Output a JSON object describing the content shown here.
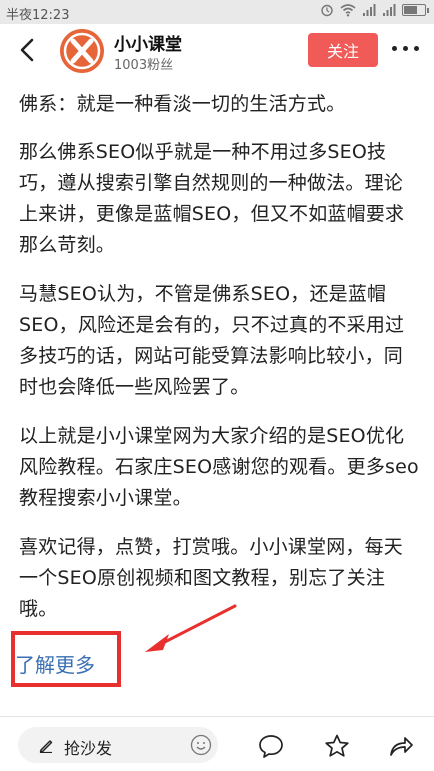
{
  "status_bar": {
    "time": "半夜12:23"
  },
  "header": {
    "account_name": "小小课堂",
    "fans": "1003粉丝",
    "follow_label": "关注",
    "avatar_color": "#e6663a",
    "follow_color": "#f05a57"
  },
  "article": {
    "paragraphs": [
      "佛系：就是一种看淡一切的生活方式。",
      "那么佛系SEO似乎就是一种不用过多SEO技巧，遵从搜索引擎自然规则的一种做法。理论上来讲，更像是蓝帽SEO，但又不如蓝帽要求那么苛刻。",
      "马慧SEO认为，不管是佛系SEO，还是蓝帽SEO，风险还是会有的，只不过真的不采用过多技巧的话，网站可能受算法影响比较小，同时也会降低一些风险罢了。",
      "以上就是小小课堂网为大家介绍的是SEO优化风险教程。石家庄SEO感谢您的观看。更多seo教程搜索小小课堂。",
      "喜欢记得，点赞，打赏哦。小小课堂网，每天一个SEO原创视频和图文教程，别忘了关注哦。"
    ],
    "more_link": "了解更多",
    "highlight_color": "#e8302e",
    "link_color": "#3a6fb3"
  },
  "bottom_bar": {
    "comment_placeholder": "抢沙发"
  },
  "icons": {
    "back": "back-arrow-icon",
    "more": "more-dots-icon",
    "pen": "pen-icon",
    "emoji": "emoji-icon",
    "comment": "comment-icon",
    "star": "star-icon",
    "share": "share-icon"
  }
}
